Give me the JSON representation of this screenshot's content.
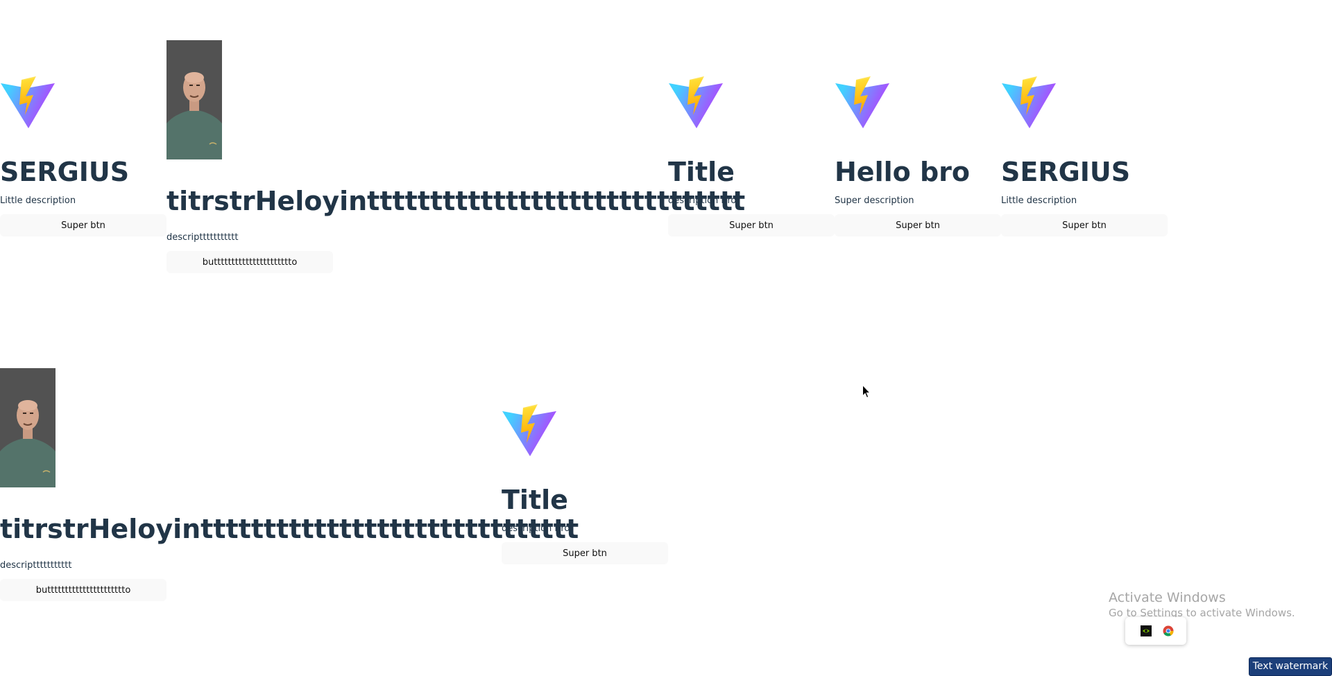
{
  "cards": [
    {
      "title": "SERGIUS",
      "description": "Little description",
      "button": "Super btn"
    },
    {
      "title": "titrstrHeloyintttttttttttttttttttttttttttttt",
      "description": "descripttttttttttt",
      "button": "butttttttttttttttttttttto"
    },
    {
      "title": "Title",
      "description": "description Bro",
      "button": "Super btn"
    },
    {
      "title": "Hello bro",
      "description": "Super description",
      "button": "Super btn"
    },
    {
      "title": "SERGIUS",
      "description": "Little description",
      "button": "Super btn"
    },
    {
      "title": "titrstrHeloyintttttttttttttttttttttttttttttt",
      "description": "descripttttttttttt",
      "button": "butttttttttttttttttttttto"
    },
    {
      "title": "Title",
      "description": "description Bro",
      "button": "Super btn"
    }
  ],
  "system": {
    "activate_title": "Activate Windows",
    "activate_subtitle": "Go to Settings to activate Windows.",
    "watermark_label": "Text watermark"
  },
  "colors": {
    "title_text": "#213547",
    "button_bg": "#f9f9f9",
    "watermark_bg": "#1c3f7a"
  },
  "icons": {
    "logo": "vite-logo-icon",
    "tray_1": "nvidia-icon",
    "tray_2": "chrome-icon"
  }
}
